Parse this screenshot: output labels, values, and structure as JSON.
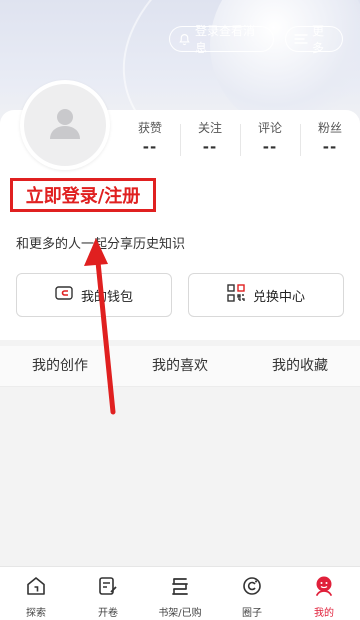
{
  "header": {
    "login_pill_label": "登录查看消息",
    "more_label": "更多"
  },
  "profile": {
    "stats": [
      {
        "label": "获赞",
        "value": "--"
      },
      {
        "label": "关注",
        "value": "--"
      },
      {
        "label": "评论",
        "value": "--"
      },
      {
        "label": "粉丝",
        "value": "--"
      }
    ],
    "login_label": "立即登录/注册",
    "subtitle": "和更多的人一起分享历史知识"
  },
  "actions": {
    "wallet_label": "我的钱包",
    "exchange_label": "兑换中心"
  },
  "tabs": [
    "我的创作",
    "我的喜欢",
    "我的收藏"
  ],
  "bottom_nav": [
    {
      "label": "探索",
      "icon": "home-icon"
    },
    {
      "label": "开卷",
      "icon": "edit-icon"
    },
    {
      "label": "书架/已购",
      "icon": "bookshelf-icon"
    },
    {
      "label": "圈子",
      "icon": "circle-icon"
    },
    {
      "label": "我的",
      "icon": "profile-icon",
      "active": true
    }
  ],
  "colors": {
    "accent_red": "#e02020",
    "active_nav": "#e0203a"
  }
}
